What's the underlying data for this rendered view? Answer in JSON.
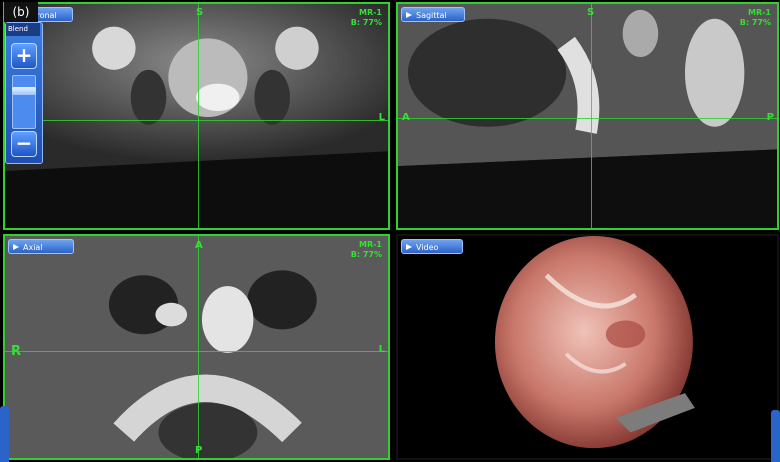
{
  "figure_label": "(b)",
  "zoom": {
    "blend_label": "Blend",
    "zoom_in": "+",
    "zoom_out": "−",
    "zoom_level_fraction": 0.25
  },
  "panes": {
    "coronal": {
      "tab": "Coronal",
      "top": "S",
      "right": "L",
      "info1": "MR-1",
      "info2": "B: 77%"
    },
    "sagittal": {
      "tab": "Sagittal",
      "top": "S",
      "left": "A",
      "right": "P",
      "info1": "MR-1",
      "info2": "B: 77%"
    },
    "axial": {
      "tab": "Axial",
      "top": "A",
      "left": "R",
      "right": "L",
      "bottom": "P",
      "info1": "MR-1",
      "info2": "B: 77%"
    },
    "video": {
      "tab": "Video"
    }
  },
  "colors": {
    "crosshair": "#2fd12f",
    "tab": "#2b63c9"
  }
}
